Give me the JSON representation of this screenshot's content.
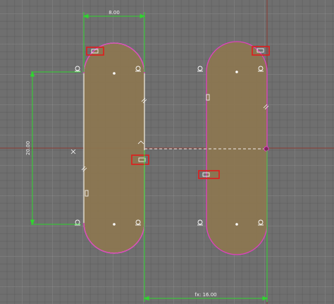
{
  "viewport": {
    "background_color": "#6f6f6f",
    "axis_color": "#8a3a30",
    "sketch_line_color": "#f5f1e6",
    "profile_fill_color": "#8c7650",
    "selected_edge_color": "#e040c0",
    "dimension_color": "#2fd62f",
    "highlight_box_color": "#e21b1b"
  },
  "dimensions": {
    "top_width_label": "8.00",
    "left_height_label": "20.00",
    "bottom_offset_label": "fx: 16.00"
  },
  "constraint_icons": [
    "tangent-icon",
    "equal-icon",
    "coincident-icon",
    "parallel-icon",
    "horizontal-icon"
  ]
}
